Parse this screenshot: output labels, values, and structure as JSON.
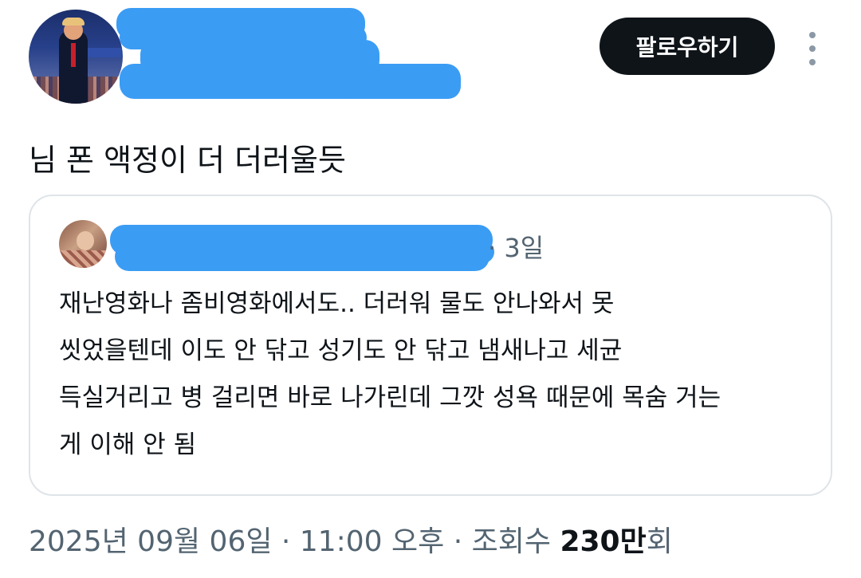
{
  "author": {
    "avatar_icon": "user-avatar-photo",
    "follow_label": "팔로우하기",
    "more_icon": "more-vertical-icon"
  },
  "tweet": {
    "text": "님 폰 액정이 더 더러울듯"
  },
  "quoted": {
    "avatar_icon": "quoted-user-avatar-photo",
    "time": "· 3일",
    "lines": [
      "재난영화나 좀비영화에서도.. 더러워 물도 안나와서 못",
      "씻었을텐데 이도 안 닦고 성기도 안 닦고 냄새나고 세균",
      "득실거리고 병 걸리면 바로 나가린데 그깟 성욕 때문에 목숨 거는",
      "게 이해 안 됨"
    ]
  },
  "meta": {
    "date": "2025년 09월 06일",
    "time": "11:00 오후",
    "views_label": "조회수",
    "views_count": "230만",
    "views_suffix": "회",
    "separator": " · "
  },
  "colors": {
    "redaction": "#3b9cf4",
    "button_bg": "#0f1419",
    "muted_text": "#536471",
    "border": "#dfe4e8"
  }
}
